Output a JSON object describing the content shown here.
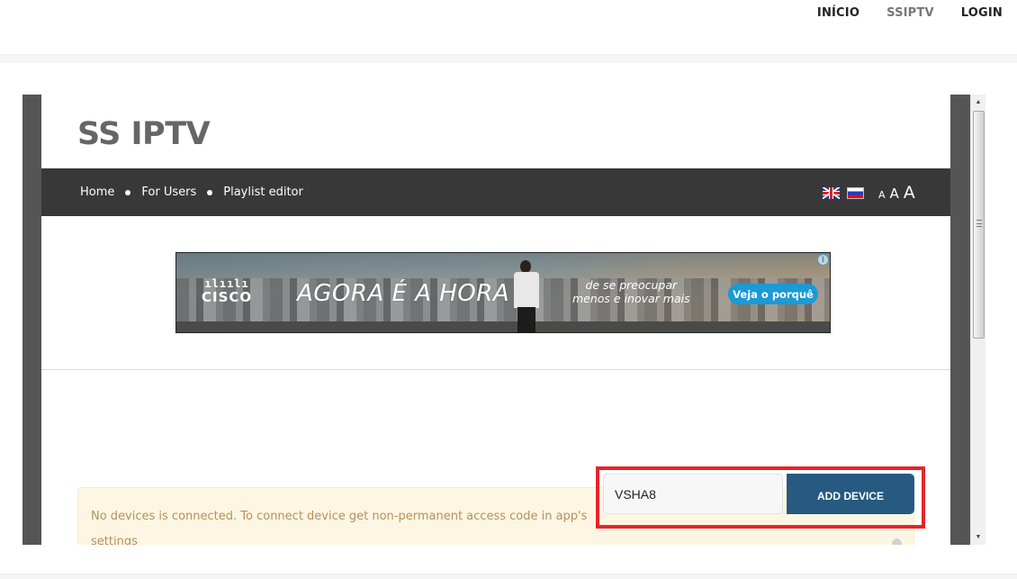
{
  "site_header": {
    "nav": [
      {
        "label": "INÍCIO",
        "active": false
      },
      {
        "label": "SSIPTV",
        "active": true
      },
      {
        "label": "LOGIN",
        "active": false
      }
    ]
  },
  "frame": {
    "title": "SS IPTV",
    "nav": {
      "links": [
        "Home",
        "For Users",
        "Playlist editor"
      ],
      "languages": [
        {
          "icon": "uk-flag-icon",
          "label": "English"
        },
        {
          "icon": "russia-flag-icon",
          "label": "Russian"
        }
      ],
      "font_sizes": [
        "A",
        "A",
        "A"
      ]
    },
    "ad": {
      "brand": "CISCO",
      "brand_bars": "ılıılı",
      "headline": "AGORA É A HORA",
      "subtext_line1": "de se preocupar",
      "subtext_line2": "menos e inovar mais",
      "cta": "Veja o porquê",
      "info_icon": "i"
    },
    "alert": {
      "message": "No devices is connected. To connect device get non-permanent access code in app's settings"
    },
    "device_form": {
      "input_value": "VSHA8",
      "button_label": "ADD DEVICE"
    }
  },
  "colors": {
    "nav_bar": "#383838",
    "button": "#265a80",
    "alert_bg": "#fcf6e3",
    "alert_text": "#b8905a",
    "highlight": "#e8232a",
    "ad_cta": "#1a9ad6"
  }
}
